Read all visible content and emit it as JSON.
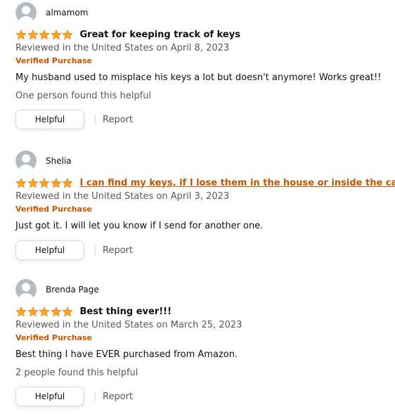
{
  "colors": {
    "star": "#ffa41c",
    "verified": "#c45500",
    "link_title": "#c45500",
    "muted_text": "#565959",
    "avatar_bg": "#b3bcc2"
  },
  "icons": {
    "avatar": "default-avatar-icon",
    "star": "star-icon"
  },
  "reviews": [
    {
      "author": "almamom",
      "rating": 5,
      "title": "Great for keeping track of keys",
      "date": "Reviewed in the United States on April 8, 2023",
      "verified": "Verified Purchase",
      "body": "My husband used to misplace his keys a lot but doesn't anymore! Works great!!",
      "helpful_count": "One person found this helpful",
      "helpful_label": "Helpful",
      "report_label": "Report"
    },
    {
      "author": "Shelia",
      "rating": 5,
      "title": "I can find my keys, if I lose them in the house or inside the car.",
      "date": "Reviewed in the United States on April 3, 2023",
      "verified": "Verified Purchase",
      "body": "Just got it. I will let you know if I send for another one.",
      "helpful_count": "",
      "helpful_label": "Helpful",
      "report_label": "Report"
    },
    {
      "author": "Brenda Page",
      "rating": 5,
      "title": "Best thing ever!!!",
      "date": "Reviewed in the United States on March 25, 2023",
      "verified": "Verified Purchase",
      "body": "Best thing I have EVER purchased from Amazon.",
      "helpful_count": "2 people found this helpful",
      "helpful_label": "Helpful",
      "report_label": "Report"
    }
  ]
}
